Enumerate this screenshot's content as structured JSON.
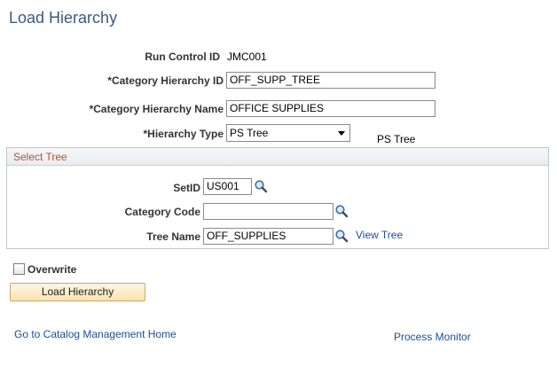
{
  "page": {
    "title": "Load Hierarchy"
  },
  "form": {
    "run_control": {
      "label": "Run Control ID",
      "value": "JMC001"
    },
    "category_hierarchy_id": {
      "label": "*Category Hierarchy ID",
      "value": "OFF_SUPP_TREE"
    },
    "category_hierarchy_name": {
      "label": "*Category Hierarchy Name",
      "value": "OFFICE SUPPLIES"
    },
    "hierarchy_type": {
      "label": "*Hierarchy Type",
      "selected": "PS Tree",
      "display": "PS Tree"
    }
  },
  "select_tree": {
    "title": "Select Tree",
    "setid": {
      "label": "SetID",
      "value": "US001"
    },
    "category_code": {
      "label": "Category Code",
      "value": ""
    },
    "tree_name": {
      "label": "Tree Name",
      "value": "OFF_SUPPLIES"
    },
    "view_tree_link": "View Tree",
    "lookup_icon": "magnifier-icon"
  },
  "overwrite": {
    "label": "Overwrite",
    "checked": false
  },
  "actions": {
    "load_button": "Load Hierarchy"
  },
  "footer": {
    "catalog_link": "Go to Catalog Management Home",
    "process_monitor_link": "Process Monitor"
  },
  "colors": {
    "title": "#3c5a82",
    "group_title": "#b2542a",
    "link": "#1b4f9c",
    "button_bg": "#fbe3b3"
  }
}
